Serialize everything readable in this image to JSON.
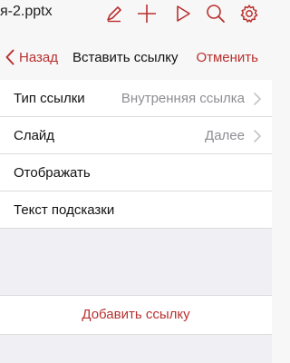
{
  "toolbar": {
    "document_title": "я-2.pptx",
    "icons": [
      "pen-icon",
      "plus-icon",
      "play-icon",
      "search-icon",
      "gear-icon"
    ]
  },
  "nav": {
    "back_label": "Назад",
    "title": "Вставить ссылку",
    "cancel_label": "Отменить"
  },
  "rows": [
    {
      "label": "Тип ссылки",
      "value": "Внутренняя ссылка",
      "has_chevron": true
    },
    {
      "label": "Слайд",
      "value": "Далее",
      "has_chevron": true
    },
    {
      "label": "Отображать",
      "value": "",
      "has_chevron": false
    },
    {
      "label": "Текст подсказки",
      "value": "",
      "has_chevron": false
    }
  ],
  "action": {
    "label": "Добавить ссылку"
  },
  "colors": {
    "accent": "#b8312f",
    "secondary_text": "#8e8e93",
    "background": "#efeff4"
  }
}
